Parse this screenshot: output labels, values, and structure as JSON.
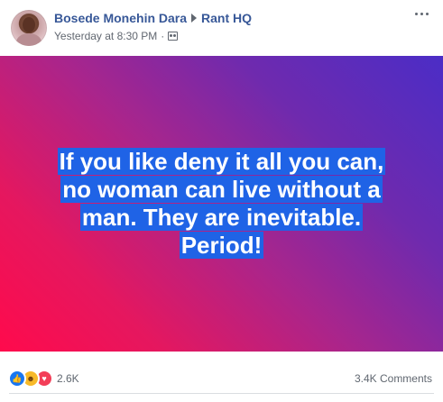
{
  "post": {
    "author": "Bosede Monehin Dara",
    "group": "Rant HQ",
    "timestamp": "Yesterday at 8:30 PM",
    "separator": "·",
    "banner_lines": [
      "If you like deny it all you can,",
      "no woman can live without a",
      "man. They are inevitable.",
      "Period!"
    ],
    "reaction_count": "2.6K",
    "comments_count": "3.4K Comments",
    "icons": {
      "avatar": "profile-photo",
      "arrow": "triangle-right-icon",
      "audience": "group-audience-icon",
      "more": "more-options-icon",
      "like": "thumbs-up-icon",
      "haha": "haha-icon",
      "love": "heart-icon"
    },
    "colors": {
      "name_link": "#385898",
      "highlight": "#1f63e6",
      "gradient_start": "#ff0a4c",
      "gradient_end": "#4b2dc6"
    }
  }
}
